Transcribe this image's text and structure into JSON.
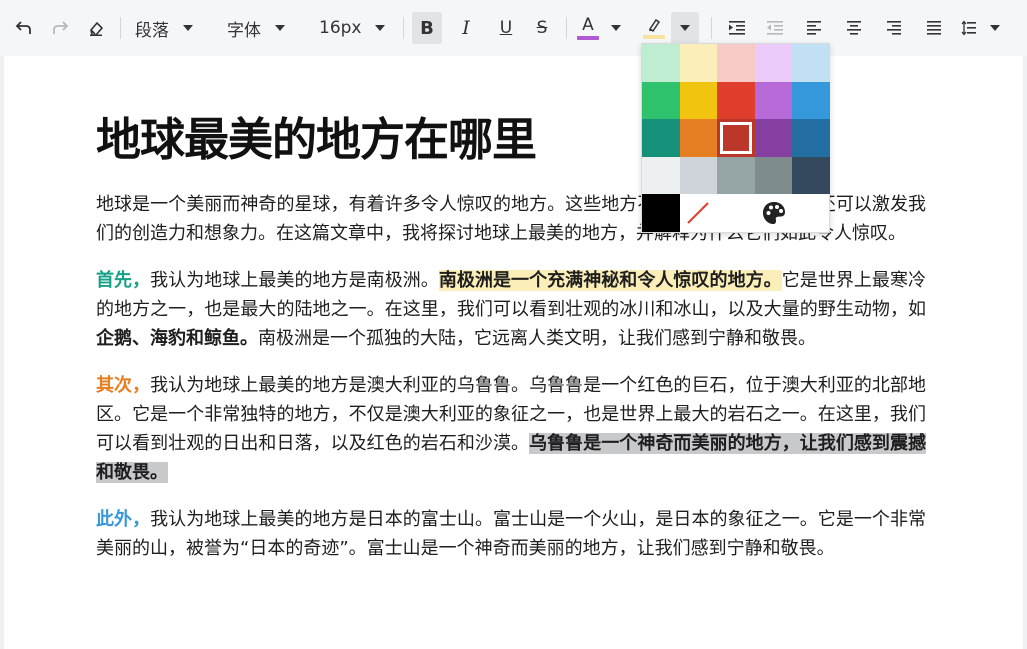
{
  "toolbar": {
    "undo_icon": "undo-icon",
    "redo_icon": "redo-icon",
    "eraser_icon": "eraser-icon",
    "block_format": "段落",
    "font_family": "字体",
    "font_size": "16px",
    "bold": "B",
    "italic": "I",
    "underline": "U",
    "strikethrough": "S",
    "text_color_glyph": "A",
    "text_color": "#b158d4",
    "highlight_color": "#f7e3a1",
    "icons": [
      "indent-icon",
      "outdent-icon",
      "align-left-icon",
      "align-center-icon",
      "align-right-icon",
      "align-justify-icon",
      "line-height-icon"
    ]
  },
  "document": {
    "title": "地球最美的地方在哪里",
    "p1": "地球是一个美丽而神奇的星球，有着许多令人惊叹的地方。这些地方不仅让我们感到震撼，还可以激发我们的创造力和想象力。在这篇文章中，我将探讨地球上最美的地方，并解释为什么它们如此令人惊叹。",
    "p2": {
      "lead": "首先，",
      "text1": "我认为地球上最美的地方是南极洲。",
      "highlight": "南极洲是一个充满神秘和令人惊叹的地方。",
      "text2": "它是世界上最寒冷的地方之一，也是最大的陆地之一。在这里，我们可以看到壮观的冰川和冰山，以及大量的野生动物，如",
      "bold": "企鹅、海豹和鲸鱼。",
      "text3": "南极洲是一个孤独的大陆，它远离人类文明，让我们感到宁静和敬畏。"
    },
    "p3": {
      "lead": "其次，",
      "text1": "我认为地球上最美的地方是澳大利亚的乌鲁鲁。乌鲁鲁是一个红色的巨石，位于澳大利亚的北部地区。它是一个非常独特的地方，不仅是澳大利亚的象征之一，也是世界上最大的岩石之一。在这里，我们可以看到壮观的日出和日落，以及红色的岩石和沙漠。",
      "highlight": "乌鲁鲁是一个神奇而美丽的地方，让我们感到震撼和敬畏。"
    },
    "p4": {
      "lead": "此外，",
      "text1": "我认为地球上最美的地方是日本的富士山。富士山是一个火山，是日本的象征之一。它是一个非常美丽的山，被誉为“日本的奇迹”。富士山是一个神奇而美丽的地方，让我们感到宁静和敬畏。"
    }
  },
  "palette": {
    "colors": [
      "#bfedd2",
      "#fbeeb8",
      "#f8cac6",
      "#eccafa",
      "#c2e0f4",
      "#2dc26b",
      "#f1c40f",
      "#e03e2d",
      "#b96ad9",
      "#3598db",
      "#169179",
      "#e67e23",
      "#ba372a",
      "#843fa1",
      "#236fa1",
      "#ecf0f1",
      "#ced4d9",
      "#95a5a6",
      "#7e8c8d",
      "#34495e",
      "#000000"
    ],
    "selected": "#ba372a",
    "remove_color_icon": "remove-color-icon",
    "custom_color_icon": "palette-icon"
  }
}
